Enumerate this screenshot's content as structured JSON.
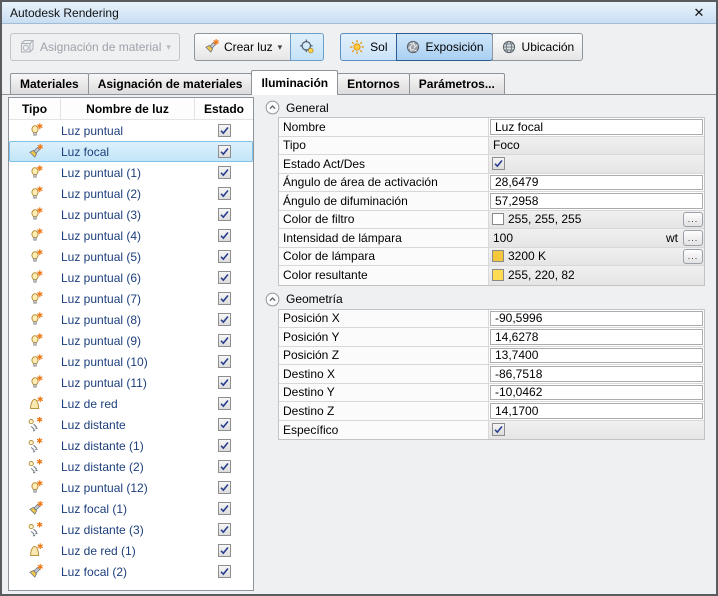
{
  "window": {
    "title": "Autodesk Rendering",
    "close_icon": "✕"
  },
  "toolbar": {
    "material_button": {
      "label": "Asignación de material",
      "enabled": false,
      "dropdown_icon": "▾"
    },
    "create_light_button": {
      "label": "Crear luz",
      "dropdown_icon": "▾"
    },
    "target_button": {
      "pressed": true
    },
    "sun_button": {
      "label": "Sol",
      "state": "toggled"
    },
    "exposure_button": {
      "label": "Exposición",
      "state": "active"
    },
    "location_button": {
      "label": "Ubicación",
      "state": "normal"
    }
  },
  "tabs": {
    "items": [
      {
        "label": "Materiales",
        "active": false
      },
      {
        "label": "Asignación de materiales",
        "active": false
      },
      {
        "label": "Iluminación",
        "active": true
      },
      {
        "label": "Entornos",
        "active": false
      },
      {
        "label": "Parámetros...",
        "active": false
      }
    ]
  },
  "light_list": {
    "columns": [
      "Tipo",
      "Nombre de luz",
      "Estado"
    ],
    "rows": [
      {
        "type": "point",
        "name": "Luz puntual",
        "checked": true,
        "selected": false
      },
      {
        "type": "spot",
        "name": "Luz focal",
        "checked": true,
        "selected": true
      },
      {
        "type": "point",
        "name": "Luz puntual (1)",
        "checked": true,
        "selected": false
      },
      {
        "type": "point",
        "name": "Luz puntual (2)",
        "checked": true,
        "selected": false
      },
      {
        "type": "point",
        "name": "Luz puntual (3)",
        "checked": true,
        "selected": false
      },
      {
        "type": "point",
        "name": "Luz puntual (4)",
        "checked": true,
        "selected": false
      },
      {
        "type": "point",
        "name": "Luz puntual (5)",
        "checked": true,
        "selected": false
      },
      {
        "type": "point",
        "name": "Luz puntual (6)",
        "checked": true,
        "selected": false
      },
      {
        "type": "point",
        "name": "Luz puntual (7)",
        "checked": true,
        "selected": false
      },
      {
        "type": "point",
        "name": "Luz puntual (8)",
        "checked": true,
        "selected": false
      },
      {
        "type": "point",
        "name": "Luz puntual (9)",
        "checked": true,
        "selected": false
      },
      {
        "type": "point",
        "name": "Luz puntual (10)",
        "checked": true,
        "selected": false
      },
      {
        "type": "point",
        "name": "Luz puntual (11)",
        "checked": true,
        "selected": false
      },
      {
        "type": "web",
        "name": "Luz de red",
        "checked": true,
        "selected": false
      },
      {
        "type": "distant",
        "name": "Luz distante",
        "checked": true,
        "selected": false
      },
      {
        "type": "distant",
        "name": "Luz distante (1)",
        "checked": true,
        "selected": false
      },
      {
        "type": "distant",
        "name": "Luz distante (2)",
        "checked": true,
        "selected": false
      },
      {
        "type": "point",
        "name": "Luz puntual (12)",
        "checked": true,
        "selected": false
      },
      {
        "type": "spot",
        "name": "Luz focal (1)",
        "checked": true,
        "selected": false
      },
      {
        "type": "distant",
        "name": "Luz distante (3)",
        "checked": true,
        "selected": false
      },
      {
        "type": "web",
        "name": "Luz de red (1)",
        "checked": true,
        "selected": false
      },
      {
        "type": "spot",
        "name": "Luz focal (2)",
        "checked": true,
        "selected": false
      }
    ]
  },
  "properties": {
    "ellipsis_label": "...",
    "sections": [
      {
        "title": "General",
        "rows": [
          {
            "label": "Nombre",
            "kind": "input",
            "value": "Luz focal"
          },
          {
            "label": "Tipo",
            "kind": "readonly",
            "value": "Foco"
          },
          {
            "label": "Estado Act/Des",
            "kind": "checkbox",
            "checked": true
          },
          {
            "label": "Ángulo de área de activación",
            "kind": "input",
            "value": "28,6479"
          },
          {
            "label": "Ángulo de difuminación",
            "kind": "input",
            "value": "57,2958"
          },
          {
            "label": "Color de filtro",
            "kind": "color",
            "swatch": "#ffffff",
            "value": "255, 255, 255",
            "button": true
          },
          {
            "label": "Intensidad de lámpara",
            "kind": "readonly",
            "value": "100",
            "unit": "wt",
            "button": true
          },
          {
            "label": "Color de lámpara",
            "kind": "color",
            "swatch": "#f5c83c",
            "value": "3200 K",
            "button": true
          },
          {
            "label": "Color resultante",
            "kind": "color",
            "swatch": "#ffdc52",
            "value": "255, 220, 82",
            "button": false
          }
        ]
      },
      {
        "title": "Geometría",
        "rows": [
          {
            "label": "Posición X",
            "kind": "input",
            "value": "-90,5996"
          },
          {
            "label": "Posición Y",
            "kind": "input",
            "value": "14,6278"
          },
          {
            "label": "Posición Z",
            "kind": "input",
            "value": "13,7400"
          },
          {
            "label": "Destino X",
            "kind": "input",
            "value": "-86,7518"
          },
          {
            "label": "Destino Y",
            "kind": "input",
            "value": "-10,0462"
          },
          {
            "label": "Destino Z",
            "kind": "input",
            "value": "14,1700"
          },
          {
            "label": "Específico",
            "kind": "checkbox",
            "checked": true
          }
        ]
      }
    ]
  },
  "colors": {
    "selection_fill": "#cde8f9",
    "selection_border": "#7fc2ea",
    "filter_color_swatch": "#ffffff",
    "lamp_color_swatch": "#f5c83c",
    "resultant_color_swatch": "#ffdc52",
    "title_bar": "#cfe3f5",
    "active_toggle": "#b5d6f2",
    "list_text": "#1d3f7c"
  }
}
